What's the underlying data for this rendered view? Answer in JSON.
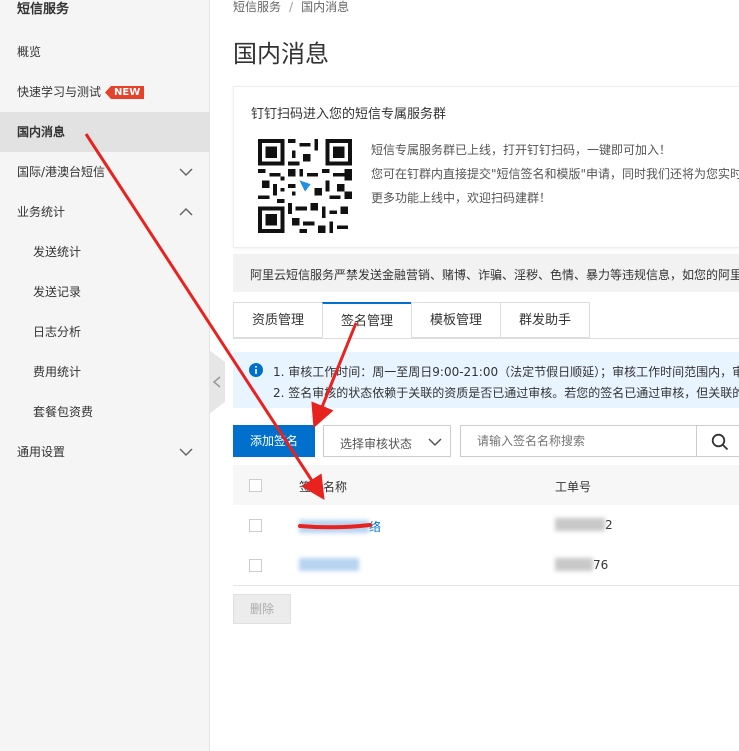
{
  "sidebar": {
    "title": "短信服务",
    "items": [
      {
        "label": "概览"
      },
      {
        "label": "快速学习与测试",
        "badge": "NEW"
      },
      {
        "label": "国内消息"
      },
      {
        "label": "国际/港澳台短信"
      },
      {
        "label": "业务统计"
      },
      {
        "label": "发送统计"
      },
      {
        "label": "发送记录"
      },
      {
        "label": "日志分析"
      },
      {
        "label": "费用统计"
      },
      {
        "label": "套餐包资费"
      },
      {
        "label": "通用设置"
      }
    ]
  },
  "breadcrumb": {
    "root": "短信服务",
    "separator": "/",
    "current": "国内消息"
  },
  "page_title": "国内消息",
  "qr_card": {
    "heading": "钉钉扫码进入您的短信专属服务群",
    "line1": "短信专属服务群已上线，打开钉钉扫码，一键即可加入！",
    "line2": "您可在钉群内直接提交\"短信签名和模版\"申请，同时我们还将为您实时",
    "line3": "更多功能上线中，欢迎扫码建群！"
  },
  "notice": "阿里云短信服务严禁发送金融营销、赌博、诈骗、淫秽、色情、暴力等违规信息，如您的阿里",
  "tabs": [
    {
      "label": "资质管理"
    },
    {
      "label": "签名管理"
    },
    {
      "label": "模板管理"
    },
    {
      "label": "群发助手"
    }
  ],
  "info": {
    "line1": "1. 审核工作时间：周一至周日9:00-21:00（法定节假日顺延）；审核工作时间范围内，审核",
    "line2": "2. 签名审核的状态依赖于关联的资质是否已通过审核。若您的签名已通过审核，但关联的"
  },
  "toolbar": {
    "add_label": "添加签名",
    "status_placeholder": "选择审核状态",
    "search_placeholder": "请输入签名名称搜索"
  },
  "table": {
    "headers": {
      "name": "签名名称",
      "order": "工单号"
    },
    "rows": [
      {
        "name_suffix": "络",
        "order_suffix": "2"
      },
      {
        "name_suffix": "",
        "order_suffix": "76"
      }
    ]
  },
  "delete_label": "删除",
  "colors": {
    "accent": "#0070cc",
    "annotation": "#e8231f",
    "new_badge": "#e5412b"
  }
}
